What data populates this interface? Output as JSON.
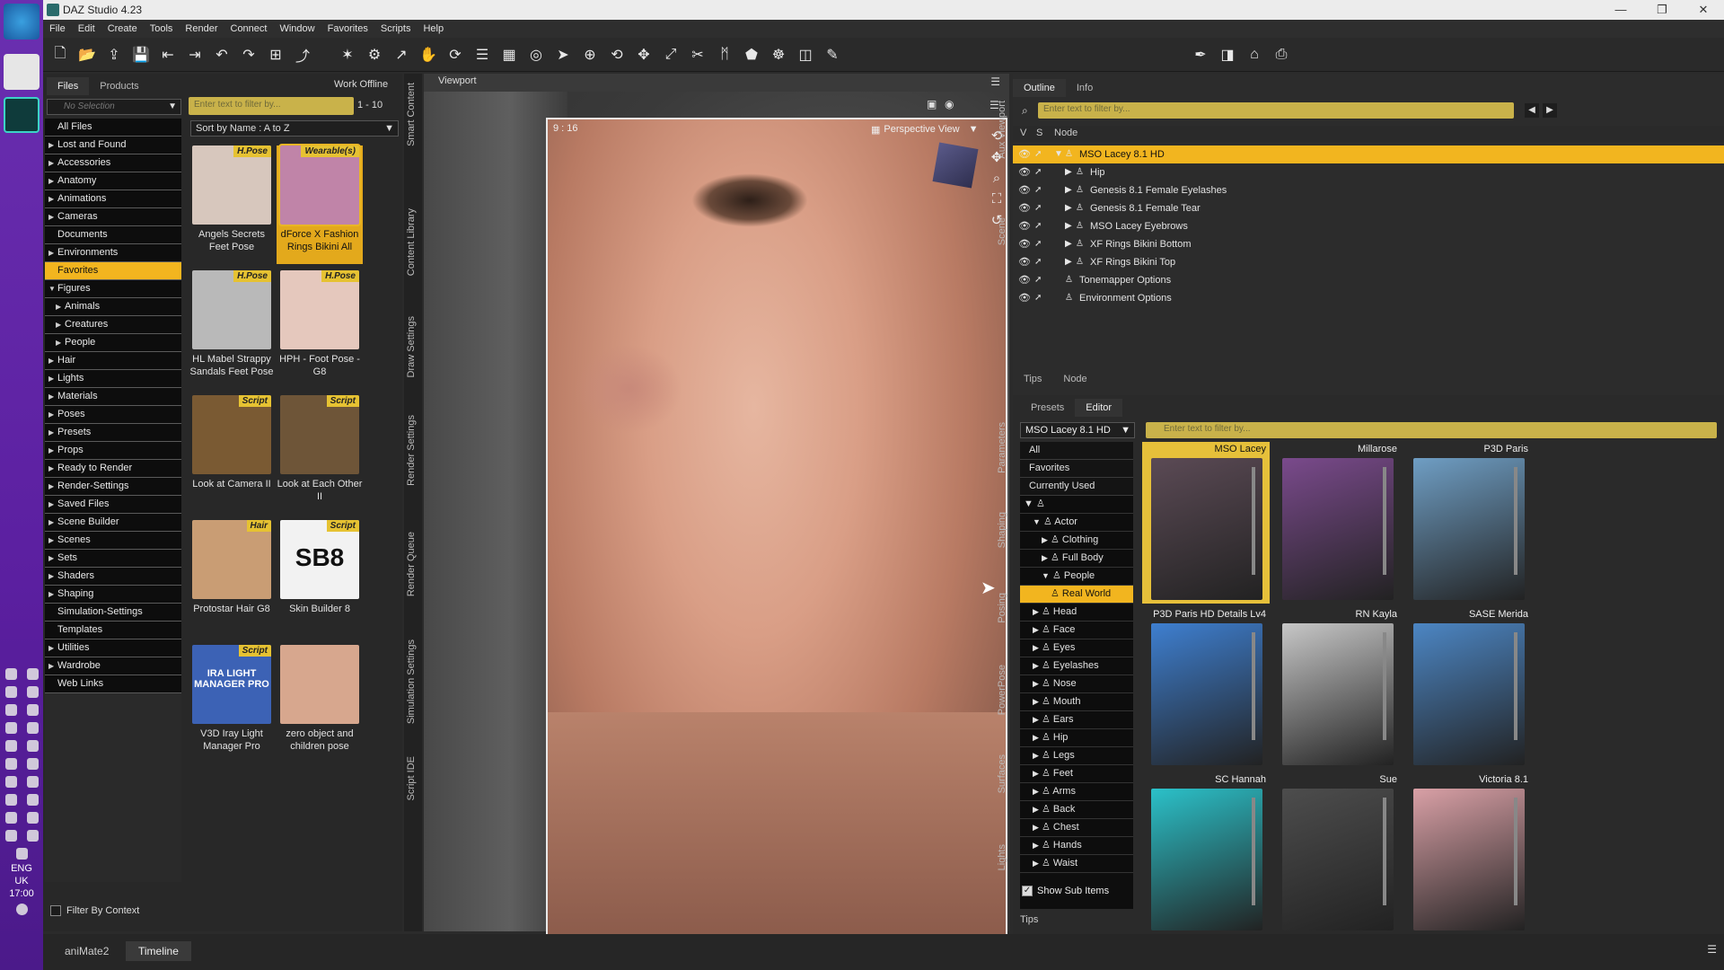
{
  "window": {
    "title": "DAZ Studio 4.23",
    "controls": [
      "—",
      "❐",
      "✕"
    ]
  },
  "menu": [
    "File",
    "Edit",
    "Create",
    "Tools",
    "Render",
    "Connect",
    "Window",
    "Favorites",
    "Scripts",
    "Help"
  ],
  "taskbar": {
    "language": "ENG",
    "region": "UK",
    "time": "17:00"
  },
  "library": {
    "tabs": [
      "Files",
      "Products"
    ],
    "work_offline": "Work Offline",
    "no_selection": "No Selection",
    "search_placeholder": "Enter text to filter by...",
    "count": "1 - 10",
    "sort": "Sort by Name : A to Z",
    "filter_by_context": "Filter By Context",
    "categories": [
      {
        "label": "All Files",
        "arrow": ""
      },
      {
        "label": "Lost and Found",
        "arrow": "▶"
      },
      {
        "label": "Accessories",
        "arrow": "▶"
      },
      {
        "label": "Anatomy",
        "arrow": "▶"
      },
      {
        "label": "Animations",
        "arrow": "▶"
      },
      {
        "label": "Cameras",
        "arrow": "▶"
      },
      {
        "label": "Documents",
        "arrow": ""
      },
      {
        "label": "Environments",
        "arrow": "▶"
      },
      {
        "label": "Favorites",
        "arrow": "",
        "selected": true
      },
      {
        "label": "Figures",
        "arrow": "▼"
      },
      {
        "label": "Animals",
        "arrow": "▶",
        "indent": true
      },
      {
        "label": "Creatures",
        "arrow": "▶",
        "indent": true
      },
      {
        "label": "People",
        "arrow": "▶",
        "indent": true
      },
      {
        "label": "Hair",
        "arrow": "▶"
      },
      {
        "label": "Lights",
        "arrow": "▶"
      },
      {
        "label": "Materials",
        "arrow": "▶"
      },
      {
        "label": "Poses",
        "arrow": "▶"
      },
      {
        "label": "Presets",
        "arrow": "▶"
      },
      {
        "label": "Props",
        "arrow": "▶"
      },
      {
        "label": "Ready to Render",
        "arrow": "▶"
      },
      {
        "label": "Render-Settings",
        "arrow": "▶"
      },
      {
        "label": "Saved Files",
        "arrow": "▶"
      },
      {
        "label": "Scene Builder",
        "arrow": "▶"
      },
      {
        "label": "Scenes",
        "arrow": "▶"
      },
      {
        "label": "Sets",
        "arrow": "▶"
      },
      {
        "label": "Shaders",
        "arrow": "▶"
      },
      {
        "label": "Shaping",
        "arrow": "▶"
      },
      {
        "label": "Simulation-Settings",
        "arrow": ""
      },
      {
        "label": "Templates",
        "arrow": ""
      },
      {
        "label": "Utilities",
        "arrow": "▶"
      },
      {
        "label": "Wardrobe",
        "arrow": "▶"
      },
      {
        "label": "Web Links",
        "arrow": ""
      }
    ],
    "tiles": [
      {
        "label": "Angels Secrets Feet Pose",
        "badge": "H.Pose",
        "color": "#d7c7bd"
      },
      {
        "label": "dForce X Fashion Rings Bikini All",
        "badge": "Wearable(s)",
        "color": "#c084a8",
        "selected": true
      },
      {
        "label": "HL Mabel Strappy Sandals Feet Pose",
        "badge": "H.Pose",
        "color": "#b9b9b9"
      },
      {
        "label": "HPH - Foot Pose - G8",
        "badge": "H.Pose",
        "color": "#e5c8bd"
      },
      {
        "label": "Look at Camera II",
        "badge": "Script",
        "color": "#7a5a33"
      },
      {
        "label": "Look at Each Other II",
        "badge": "Script",
        "color": "#6e5538"
      },
      {
        "label": "Protostar Hair G8",
        "badge": "Hair",
        "color": "#c99d74"
      },
      {
        "label": "Skin Builder 8",
        "badge": "Script",
        "color": "#f2f2f2",
        "text": "SB8"
      },
      {
        "label": "V3D Iray Light Manager Pro",
        "badge": "Script",
        "color": "#3c62b5",
        "text": "IRA LIGHT MANAGER PRO"
      },
      {
        "label": "zero object and children pose",
        "badge": "",
        "color": "#d7a78e"
      }
    ]
  },
  "side_tabs": [
    "Smart Content",
    "Content Library",
    "Draw Settings",
    "Render Settings",
    "Render Queue",
    "Simulation Settings",
    "Script IDE"
  ],
  "viewport": {
    "tab": "Viewport",
    "ratio": "9 : 16",
    "view": "Perspective View"
  },
  "outline": {
    "tabs": [
      "Outline",
      "Info"
    ],
    "search_placeholder": "Enter text to filter by...",
    "cols": [
      "V",
      "S",
      "Node"
    ],
    "nodes": [
      {
        "label": "MSO Lacey 8.1 HD",
        "selected": true,
        "arrow": "▼",
        "depth": 0
      },
      {
        "label": "Hip",
        "arrow": "▶",
        "depth": 1
      },
      {
        "label": "Genesis 8.1 Female Eyelashes",
        "arrow": "▶",
        "depth": 1
      },
      {
        "label": "Genesis 8.1 Female Tear",
        "arrow": "▶",
        "depth": 1
      },
      {
        "label": "MSO Lacey Eyebrows",
        "arrow": "▶",
        "depth": 1
      },
      {
        "label": "XF Rings Bikini Bottom",
        "arrow": "▶",
        "depth": 1
      },
      {
        "label": "XF Rings Bikini Top",
        "arrow": "▶",
        "depth": 1
      },
      {
        "label": "Tonemapper Options",
        "arrow": "",
        "depth": 0
      },
      {
        "label": "Environment Options",
        "arrow": "",
        "depth": 0
      }
    ],
    "side_tabs": [
      "Aux Viewport",
      "Scene"
    ],
    "bottom_tabs": [
      "Tips",
      "Node"
    ]
  },
  "presets": {
    "tabs": [
      "Presets",
      "Editor"
    ],
    "figure": "MSO Lacey 8.1 HD",
    "search_placeholder": "Enter text to filter by...",
    "top_cats": [
      "All",
      "Favorites",
      "Currently Used"
    ],
    "tree": [
      {
        "label": "Actor",
        "arrow": "▼",
        "depth": 1
      },
      {
        "label": "Clothing",
        "arrow": "▶",
        "depth": 2
      },
      {
        "label": "Full Body",
        "arrow": "▶",
        "depth": 2
      },
      {
        "label": "People",
        "arrow": "▼",
        "depth": 2
      },
      {
        "label": "Real World",
        "arrow": "",
        "depth": 3,
        "selected": true
      },
      {
        "label": "Head",
        "arrow": "▶",
        "depth": 1
      },
      {
        "label": "Face",
        "arrow": "▶",
        "depth": 1
      },
      {
        "label": "Eyes",
        "arrow": "▶",
        "depth": 1
      },
      {
        "label": "Eyelashes",
        "arrow": "▶",
        "depth": 1
      },
      {
        "label": "Nose",
        "arrow": "▶",
        "depth": 1
      },
      {
        "label": "Mouth",
        "arrow": "▶",
        "depth": 1
      },
      {
        "label": "Ears",
        "arrow": "▶",
        "depth": 1
      },
      {
        "label": "Hip",
        "arrow": "▶",
        "depth": 1
      },
      {
        "label": "Legs",
        "arrow": "▶",
        "depth": 1
      },
      {
        "label": "Feet",
        "arrow": "▶",
        "depth": 1
      },
      {
        "label": "Arms",
        "arrow": "▶",
        "depth": 1
      },
      {
        "label": "Back",
        "arrow": "▶",
        "depth": 1
      },
      {
        "label": "Chest",
        "arrow": "▶",
        "depth": 1
      },
      {
        "label": "Hands",
        "arrow": "▶",
        "depth": 1
      },
      {
        "label": "Waist",
        "arrow": "▶",
        "depth": 1
      }
    ],
    "show_sub_items": "Show Sub Items",
    "items": [
      {
        "name": "MSO Lacey",
        "color": "#5b4a55",
        "selected": true
      },
      {
        "name": "Millarose",
        "color": "#7a4a8c"
      },
      {
        "name": "P3D Paris",
        "color": "#6f9ec4"
      },
      {
        "name": "P3D Paris HD Details Lv4",
        "color": "#3e7fd0"
      },
      {
        "name": "RN Kayla",
        "color": "#c7c7c7"
      },
      {
        "name": "SASE Merida",
        "color": "#4c86c4"
      },
      {
        "name": "SC Hannah",
        "color": "#2bc1c9"
      },
      {
        "name": "Sue",
        "color": "#4d4d4d"
      },
      {
        "name": "Victoria 8.1",
        "color": "#d9a0a6"
      }
    ],
    "side_tabs": [
      "Parameters",
      "Shaping",
      "Posing",
      "PowerPose",
      "Surfaces",
      "Lights"
    ],
    "tips": "Tips"
  },
  "bottom_tabs": [
    "aniMate2",
    "Timeline"
  ]
}
